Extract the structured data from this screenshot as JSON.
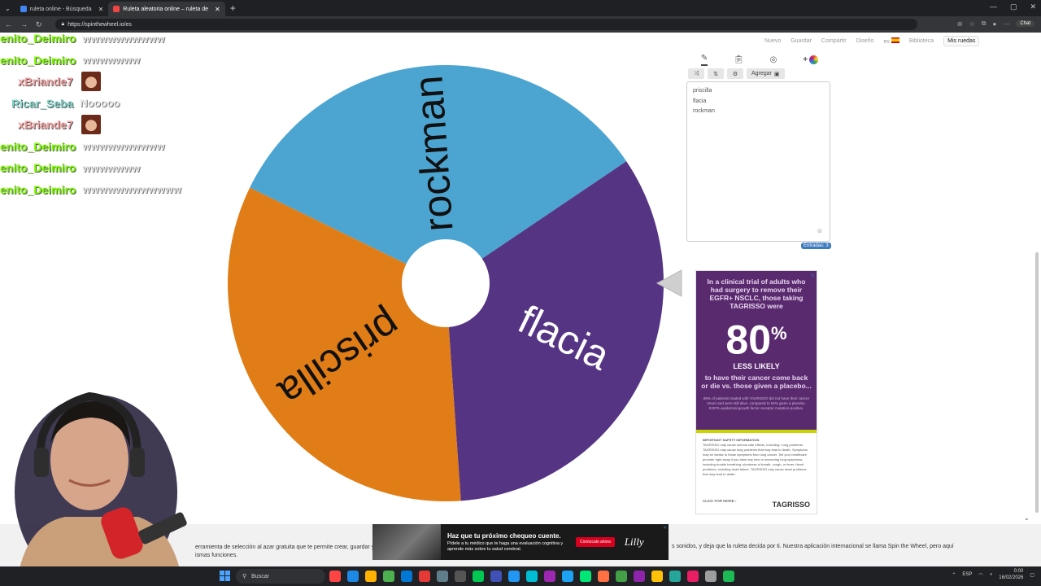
{
  "browser": {
    "tabs": [
      {
        "title": "ruleta online - Búsqueda",
        "color": "#4285f4"
      },
      {
        "title": "Ruleta aleatoria online – ruleta de",
        "color": "#e44"
      }
    ],
    "url": "https://spinthewheel.io/es",
    "chat_button": "Chat"
  },
  "site_header": {
    "items": [
      "Nuevo",
      "Guardar",
      "Compartir",
      "Diseño",
      "es",
      "Biblioteca"
    ],
    "my_wheels": "Mis ruedas"
  },
  "chat_overlay": {
    "messages": [
      {
        "user": "enito_Deimiro",
        "text": "wwwwwwwwww",
        "color": "green"
      },
      {
        "user": "enito_Deimiro",
        "text": "wwwwwww",
        "color": "green"
      },
      {
        "user": "xBriande7",
        "text": "",
        "emote": true,
        "color": "red"
      },
      {
        "user": "Ricar_Seba",
        "text": "Nooooo",
        "color": "teal"
      },
      {
        "user": "xBriande7",
        "text": "",
        "emote": true,
        "color": "red"
      },
      {
        "user": "enito_Deimiro",
        "text": "wwwwwwwwww",
        "color": "green"
      },
      {
        "user": "enito_Deimiro",
        "text": "wwwwwww",
        "color": "green"
      },
      {
        "user": "enito_Deimiro",
        "text": "wwwwwwwwwwww",
        "color": "green"
      }
    ]
  },
  "wheel": {
    "segments": [
      {
        "label": "rockman",
        "color": "#4ca5d1",
        "label_color": "#111111"
      },
      {
        "label": "flacia",
        "color": "#553583",
        "label_color": "#ffffff"
      },
      {
        "label": "priscilla",
        "color": "#e07d16",
        "label_color": "#111111"
      }
    ]
  },
  "entries": {
    "toolbar_icons": [
      "pencil-icon",
      "clipboard-icon",
      "eye-slash-icon",
      "color-wheel-icon"
    ],
    "actions": [
      "⤨",
      "⇅",
      "⚙"
    ],
    "add_label": "Agregar",
    "list": [
      "priscilla",
      "flacia",
      "rockman"
    ],
    "count_label": "Entradas: 3"
  },
  "ad": {
    "lead": "In a clinical trial of adults who had surgery to remove their EGFR+ NSCLC, those taking TAGRISSO were",
    "big": "80",
    "big_suffix": "%",
    "less": "LESS LIKELY",
    "sub": "to have their cancer come back or die vs. those given a placebo...",
    "small": "89% of patients treated with TAGRISSO did not have their cancer return and were still alive, compared to 54% given a placebo. EGFR=epidermal growth factor receptor mutation-positive.",
    "safety_title": "IMPORTANT SAFETY INFORMATION",
    "safety_body": "TAGRISSO may cause serious side effects, including: Lung problems. TAGRISSO may cause lung problems that may lead to death. Symptoms may be similar to those symptoms from lung cancer. Tell your healthcare provider right away if you have any new or worsening lung symptoms, including trouble breathing, shortness of breath, cough, or fever. Heart problems, including heart failure. TAGRISSO may cause heart problems that may lead to death.",
    "click": "CLICK FOR MORE ›",
    "logo": "TAGRISSO"
  },
  "page_text": {
    "left": "erramienta de selección al azar gratuita que te permite crear, guardar y",
    "right": "s sonidos, y deja que la ruleta decida por ti. Nuestra aplicación internacional se llama Spin the Wheel, pero aquí",
    "line2": "ismas funciones."
  },
  "banner": {
    "title": "Haz que tu próximo chequeo cuente.",
    "body": "Pídele a tu médico que te haga una evaluación cognitiva y aprende más sobre tu salud cerebral.",
    "button": "Conózcalo ahora",
    "logo": "Lilly"
  },
  "taskbar": {
    "search": "Buscar",
    "lang": "ESP",
    "time": "0:00",
    "date": "16/02/2026"
  }
}
